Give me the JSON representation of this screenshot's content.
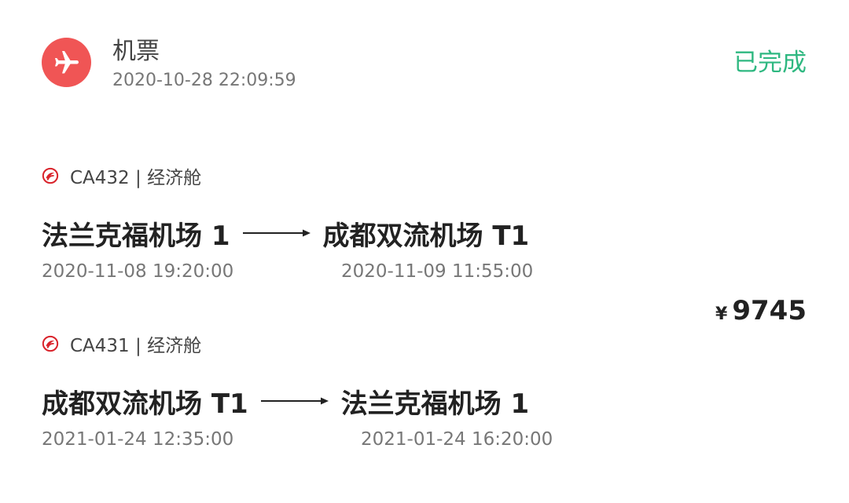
{
  "order": {
    "category": "机票",
    "datetime": "2020-10-28 22:09:59",
    "status": "已完成",
    "icon": "airplane-icon",
    "colors": {
      "icon_bg": "#f05555",
      "status": "#2fb881",
      "airline_logo": "#d9232b"
    }
  },
  "segments": [
    {
      "flight": "CA432 | 经济舱",
      "departure": {
        "airport": "法兰克福机场 1",
        "time": "2020-11-08 19:20:00"
      },
      "arrival": {
        "airport": "成都双流机场 T1",
        "time": "2020-11-09 11:55:00"
      }
    },
    {
      "flight": "CA431 | 经济舱",
      "departure": {
        "airport": "成都双流机场 T1",
        "time": "2021-01-24 12:35:00"
      },
      "arrival": {
        "airport": "法兰克福机场 1",
        "time": "2021-01-24 16:20:00"
      }
    }
  ],
  "price": {
    "currency": "¥",
    "amount": "9745"
  }
}
